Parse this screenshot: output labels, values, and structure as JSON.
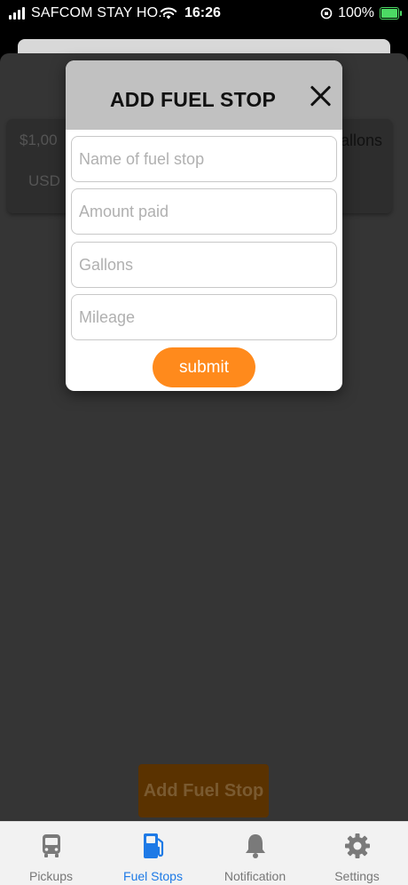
{
  "status_bar": {
    "carrier": "SAFCOM STAY HO...",
    "time": "16:26",
    "battery": "100%"
  },
  "background": {
    "amount_partial": "$1,00",
    "currency_partial": "USD",
    "gallons_partial": "allons",
    "add_button_label": "Add Fuel Stop"
  },
  "modal": {
    "title": "ADD FUEL STOP",
    "fields": [
      {
        "placeholder": "Name of fuel stop",
        "value": ""
      },
      {
        "placeholder": "Amount paid",
        "value": ""
      },
      {
        "placeholder": "Gallons",
        "value": ""
      },
      {
        "placeholder": "Mileage",
        "value": ""
      }
    ],
    "submit_label": "submit"
  },
  "tabs": [
    {
      "label": "Pickups",
      "icon": "bus-icon",
      "active": false
    },
    {
      "label": "Fuel  Stops",
      "icon": "fuel-pump-icon",
      "active": true
    },
    {
      "label": "Notification",
      "icon": "bell-icon",
      "active": false
    },
    {
      "label": "Settings",
      "icon": "gear-icon",
      "active": false
    }
  ],
  "colors": {
    "accent_orange": "#ff8a1c",
    "active_tab": "#1e7ae6",
    "inactive_tab": "#777777",
    "battery_green": "#4cd964"
  }
}
